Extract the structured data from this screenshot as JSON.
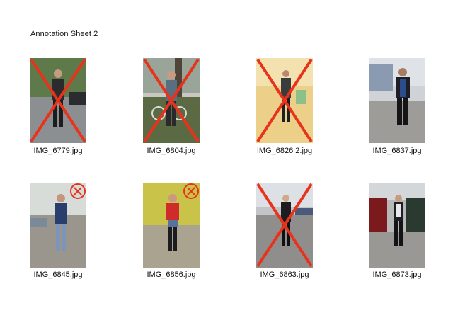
{
  "sheet": {
    "title": "Annotation Sheet 2"
  },
  "photos": [
    {
      "filename": "IMG_6779.jpg",
      "mark": "cross"
    },
    {
      "filename": "IMG_6804.jpg",
      "mark": "cross"
    },
    {
      "filename": "IMG_6826 2.jpg",
      "mark": "cross"
    },
    {
      "filename": "IMG_6837.jpg",
      "mark": "none"
    },
    {
      "filename": "IMG_6845.jpg",
      "mark": "badge"
    },
    {
      "filename": "IMG_6856.jpg",
      "mark": "badge"
    },
    {
      "filename": "IMG_6863.jpg",
      "mark": "cross"
    },
    {
      "filename": "IMG_6873.jpg",
      "mark": "none"
    }
  ],
  "colors": {
    "mark_red": "#e8331c"
  }
}
